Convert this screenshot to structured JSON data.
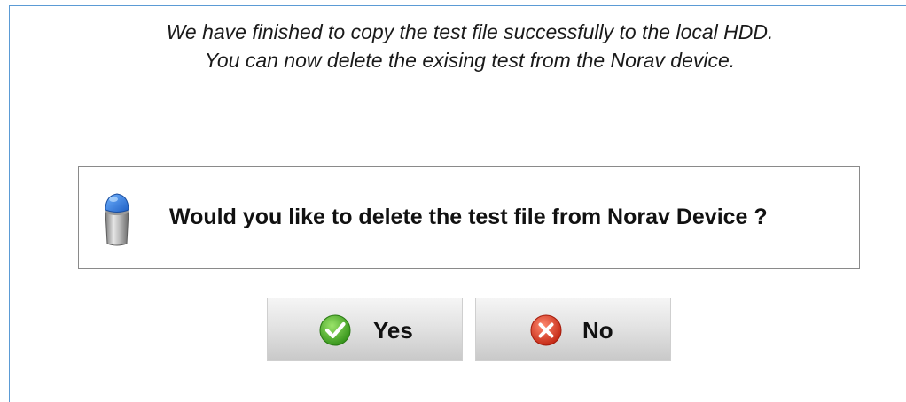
{
  "dialog": {
    "info_message": "We have finished to copy the test file successfully to the local HDD. You can now delete the exising test from the Norav device.",
    "question": "Would you like to delete the test file from Norav Device ?",
    "question_icon": "trash-can-icon"
  },
  "buttons": {
    "yes": {
      "label": "Yes",
      "icon": "checkmark-icon"
    },
    "no": {
      "label": "No",
      "icon": "close-icon"
    }
  },
  "colors": {
    "frame_border": "#5b9bd5",
    "yes_icon": "#4caf2a",
    "no_icon": "#d9341f"
  }
}
